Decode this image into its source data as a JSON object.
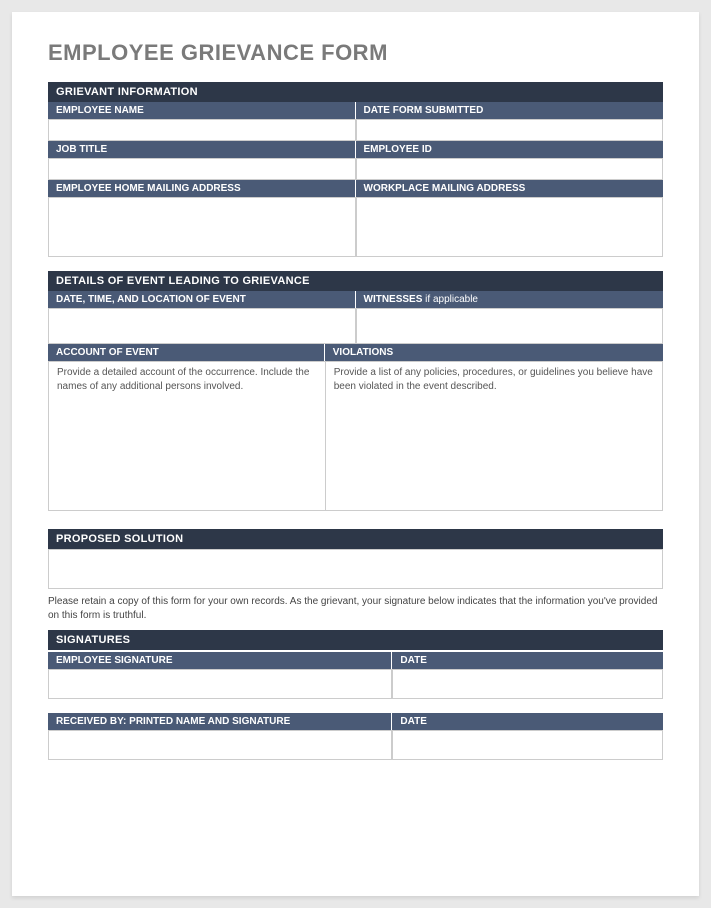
{
  "title": "EMPLOYEE GRIEVANCE FORM",
  "sections": {
    "grievant": {
      "header": "GRIEVANT INFORMATION",
      "fields": {
        "employee_name": "EMPLOYEE NAME",
        "date_submitted": "DATE FORM SUBMITTED",
        "job_title": "JOB TITLE",
        "employee_id": "EMPLOYEE ID",
        "home_address": "EMPLOYEE HOME MAILING ADDRESS",
        "workplace_address": "WORKPLACE MAILING ADDRESS"
      }
    },
    "details": {
      "header": "DETAILS OF EVENT LEADING TO GRIEVANCE",
      "fields": {
        "date_time_location": "DATE, TIME, AND LOCATION OF EVENT",
        "witnesses_bold": "WITNESSES",
        "witnesses_rest": " if applicable",
        "account": "ACCOUNT OF EVENT",
        "account_hint": "Provide a detailed account of the occurrence. Include the names of any additional persons involved.",
        "violations": "VIOLATIONS",
        "violations_hint": "Provide a list of any policies, procedures, or guidelines you believe have been violated in the event described."
      }
    },
    "proposed": {
      "header": "PROPOSED SOLUTION"
    },
    "disclaimer": "Please retain a copy of this form for your own records.  As the grievant, your signature below indicates that the information you've provided on this form is truthful.",
    "signatures": {
      "header": "SIGNATURES",
      "fields": {
        "employee_signature": "EMPLOYEE SIGNATURE",
        "date1": "DATE",
        "received_by": "RECEIVED BY: PRINTED NAME AND SIGNATURE",
        "date2": "DATE"
      }
    }
  }
}
